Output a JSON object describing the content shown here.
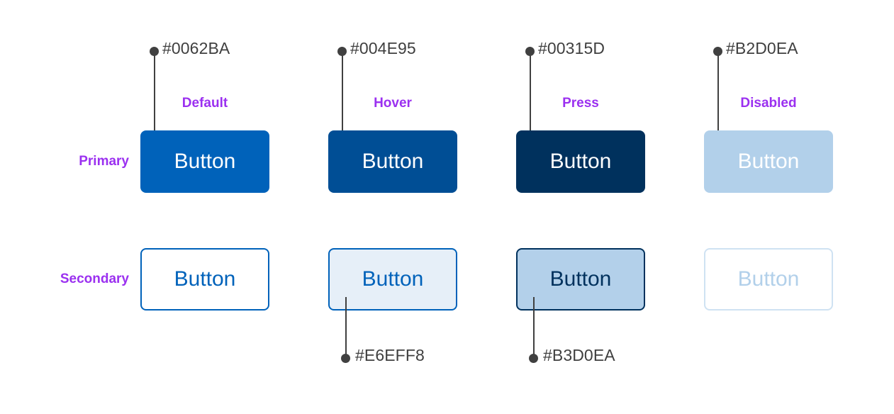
{
  "page": {
    "background": "#FFFFFF",
    "annotation_color": "#404040",
    "label_color": "#9B30F0",
    "hex_text_color": "#3F3F3F"
  },
  "rows": [
    {
      "key": "primary",
      "label": "Primary"
    },
    {
      "key": "secondary",
      "label": "Secondary"
    }
  ],
  "states": [
    {
      "key": "default",
      "label": "Default"
    },
    {
      "key": "hover",
      "label": "Hover"
    },
    {
      "key": "press",
      "label": "Press"
    },
    {
      "key": "disabled",
      "label": "Disabled"
    }
  ],
  "button_label": "Button",
  "primary": {
    "default": {
      "label": "Button",
      "bg": "#0062BA",
      "text": "#FFFFFF",
      "border": "none"
    },
    "hover": {
      "label": "Button",
      "bg": "#004E95",
      "text": "#FFFFFF",
      "border": "none"
    },
    "press": {
      "label": "Button",
      "bg": "#00315D",
      "text": "#FFFFFF",
      "border": "none"
    },
    "disabled": {
      "label": "Button",
      "bg": "#B2D0EA",
      "text": "#FFFFFF",
      "border": "none"
    }
  },
  "secondary": {
    "default": {
      "label": "Button",
      "bg": "#FFFFFF",
      "text": "#0062BA",
      "border": "#0062BA"
    },
    "hover": {
      "label": "Button",
      "bg": "#E6EFF8",
      "text": "#0062BA",
      "border": "#0062BA"
    },
    "press": {
      "label": "Button",
      "bg": "#B3D0EA",
      "text": "#00315D",
      "border": "#00315D"
    },
    "disabled": {
      "label": "Button",
      "bg": "#FFFFFF",
      "text": "#B2D0EA",
      "border": "#CFE2F2"
    }
  },
  "callouts_top": [
    {
      "hex": "#0062BA",
      "target": "primary-default"
    },
    {
      "hex": "#004E95",
      "target": "primary-hover"
    },
    {
      "hex": "#00315D",
      "target": "primary-press"
    },
    {
      "hex": "#B2D0EA",
      "target": "primary-disabled"
    }
  ],
  "callouts_bottom": [
    {
      "hex": "#E6EFF8",
      "target": "secondary-hover"
    },
    {
      "hex": "#B3D0EA",
      "target": "secondary-press"
    }
  ]
}
